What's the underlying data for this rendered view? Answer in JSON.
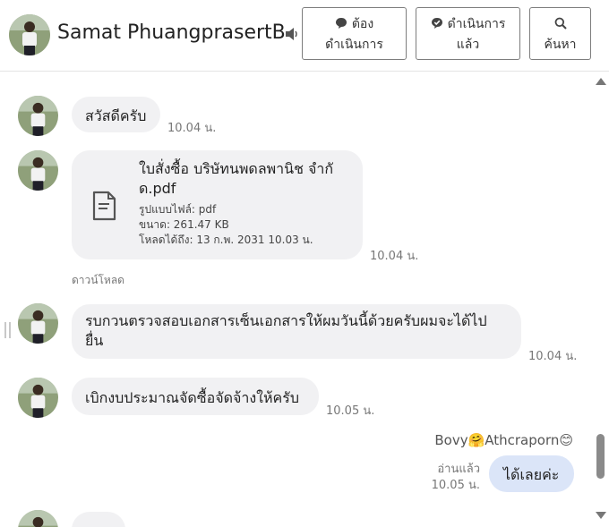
{
  "contact": {
    "name": "Samat PhuangprasertB"
  },
  "header_buttons": [
    {
      "line1": "ต้อง",
      "line2": "ดำเนินการ",
      "icon": "chat-bubble-icon"
    },
    {
      "line1": "ดำเนินการ",
      "line2": "แล้ว",
      "icon": "check-bubble-icon"
    },
    {
      "line1": "",
      "line2": "ค้นหา",
      "icon": "search-icon"
    }
  ],
  "messages": [
    {
      "text": "สวัสดีครับ",
      "time": "10.04 น."
    },
    {
      "file": {
        "title_line1": "ใบสั่งซื้อ บริษัทนพดลพานิช จำกั",
        "title_line2": "ด.pdf",
        "type": "รูปแบบไฟล์: pdf",
        "size": "ขนาด: 261.47 KB",
        "expiry": "โหลดได้ถึง: 13 ก.พ. 2031 10.03 น."
      },
      "time": "10.04 น.",
      "download_label": "ดาวน์โหลด"
    },
    {
      "text_line1": "รบกวนตรวจสอบเอกสารเซ็นเอกสารให้ผมวันนี้ด้วยครับผมจะได้ไป",
      "text_line2": "ยื่น",
      "time": "10.04 น."
    },
    {
      "text": "เบิกงบประมาณจัดซื้อจัดจ้างให้ครับ",
      "time": "10.05 น."
    }
  ],
  "outgoing": {
    "sender": "Bovy🤗Athcraporn😊",
    "text": "ได้เลยค่ะ",
    "read_label": "อ่านแล้ว",
    "time": "10.05 น."
  },
  "colors": {
    "incoming_bubble": "#f1f1f3",
    "outgoing_bubble": "#dbe5f8",
    "timestamp": "#777777"
  }
}
